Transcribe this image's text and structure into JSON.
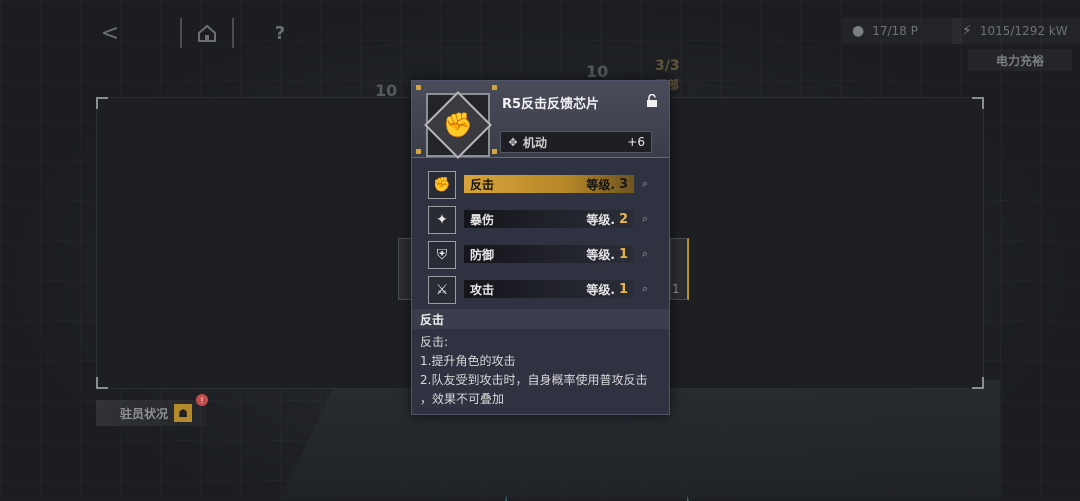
{
  "topbar": {
    "back_icon": "<",
    "help_icon": "?",
    "crew": "17/18 P",
    "power": "1015/1292 kW",
    "power_status": "电力充裕"
  },
  "background": {
    "label_10a": "10",
    "label_10b": "10",
    "label_33": "3/3",
    "label_dept": "挥部",
    "tab_num": "1",
    "crew_status": "驻员状况",
    "crew_badge": "!"
  },
  "popup": {
    "title": "R5反击反馈芯片",
    "stat": {
      "name": "机动",
      "value": "+6"
    },
    "skills": [
      {
        "name": "反击",
        "level_label": "等级.",
        "level": "3",
        "active": true
      },
      {
        "name": "暴伤",
        "level_label": "等级.",
        "level": "2",
        "active": false
      },
      {
        "name": "防御",
        "level_label": "等级.",
        "level": "1",
        "active": false
      },
      {
        "name": "攻击",
        "level_label": "等级.",
        "level": "1",
        "active": false
      }
    ],
    "desc_title": "反击",
    "desc_lines": [
      "反击:",
      "1.提升角色的攻击",
      "2.队友受到攻击时，自身概率使用普攻反击",
      "，效果不可叠加"
    ]
  },
  "colors": {
    "accent_gold": "#d8a43a",
    "popup_bg": "#2f3240"
  }
}
